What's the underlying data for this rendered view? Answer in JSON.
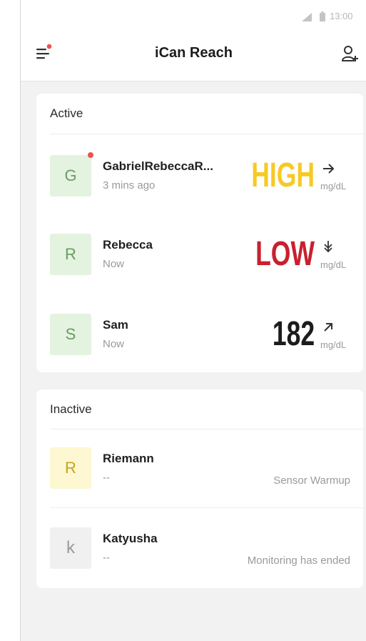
{
  "status_bar": {
    "time": "13:00"
  },
  "header": {
    "title": "iCan Reach"
  },
  "active": {
    "title": "Active",
    "items": [
      {
        "initial": "G",
        "name": "GabrielRebeccaR...",
        "time": "3 mins ago",
        "value": "HIGH",
        "unit": "mg/dL",
        "trend": "arrow-right"
      },
      {
        "initial": "R",
        "name": "Rebecca",
        "time": "Now",
        "value": "LOW",
        "unit": "mg/dL",
        "trend": "arrow-down"
      },
      {
        "initial": "S",
        "name": "Sam",
        "time": "Now",
        "value": "182",
        "unit": "mg/dL",
        "trend": "arrow-up-right"
      }
    ]
  },
  "inactive": {
    "title": "Inactive",
    "items": [
      {
        "initial": "R",
        "name": "Riemann",
        "time": "--",
        "status": "Sensor Warmup"
      },
      {
        "initial": "k",
        "name": "Katyusha",
        "time": "--",
        "status": "Monitoring has ended"
      }
    ]
  },
  "colors": {
    "high": "#f7c925",
    "low": "#c8202f",
    "notification_dot": "#ef5050",
    "avatar_green": "#e3f3df",
    "avatar_yellow": "#fdf7d2"
  }
}
